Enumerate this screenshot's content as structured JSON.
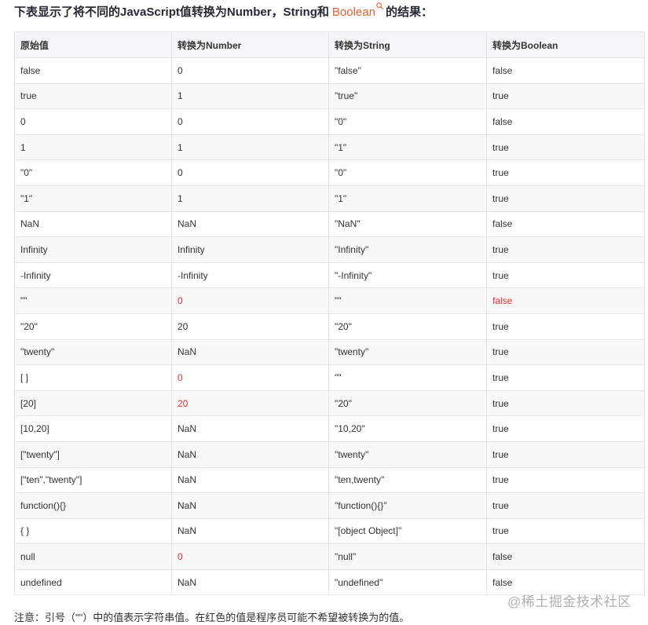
{
  "heading": {
    "before": "下表显示了将不同的JavaScript值转换为Number，String和",
    "link": "Boolean",
    "after": "的结果："
  },
  "table": {
    "headers": [
      "原始值",
      "转换为Number",
      "转换为String",
      "转换为Boolean"
    ],
    "rows": [
      [
        "false",
        "0",
        "\"false\"",
        "false"
      ],
      [
        "true",
        "1",
        "\"true\"",
        "true"
      ],
      [
        "0",
        "0",
        "\"0\"",
        "false"
      ],
      [
        "1",
        "1",
        "\"1\"",
        "true"
      ],
      [
        "\"0\"",
        "0",
        "\"0\"",
        "true"
      ],
      [
        "\"1\"",
        "1",
        "\"1\"",
        "true"
      ],
      [
        "NaN",
        "NaN",
        "\"NaN\"",
        "false"
      ],
      [
        "Infinity",
        "Infinity",
        "\"Infinity\"",
        "true"
      ],
      [
        "-Infinity",
        "-Infinity",
        "\"-Infinity\"",
        "true"
      ],
      [
        "\"\"",
        "0",
        "\"\"",
        "false"
      ],
      [
        "\"20\"",
        "20",
        "\"20\"",
        "true"
      ],
      [
        "\"twenty\"",
        "NaN",
        "\"twenty\"",
        "true"
      ],
      [
        "[ ]",
        "0",
        "\"\"",
        "true"
      ],
      [
        "[20]",
        "20",
        "\"20\"",
        "true"
      ],
      [
        "[10,20]",
        "NaN",
        "\"10,20\"",
        "true"
      ],
      [
        "[\"twenty\"]",
        "NaN",
        "\"twenty\"",
        "true"
      ],
      [
        "[\"ten\",\"twenty\"]",
        "NaN",
        "\"ten,twenty\"",
        "true"
      ],
      [
        "function(){}",
        "NaN",
        "\"function(){}\"",
        "true"
      ],
      [
        "{ }",
        "NaN",
        "\"[object Object]\"",
        "true"
      ],
      [
        "null",
        "0",
        "\"null\"",
        "false"
      ],
      [
        "undefined",
        "NaN",
        "\"undefined\"",
        "false"
      ]
    ],
    "highlight_cells": [
      [
        9,
        1
      ],
      [
        9,
        3
      ],
      [
        12,
        1
      ],
      [
        13,
        1
      ],
      [
        19,
        1
      ]
    ]
  },
  "note": "注意：引号（\"\"）中的值表示字符串值。在红色的值是程序员可能不希望被转换为的值。",
  "watermark": "@稀土掘金技术社区",
  "colors": {
    "link": "#e8602c",
    "highlight": "#e62d2d",
    "header_bg": "#f4f6f7",
    "stripe_bg": "#f8f8f8",
    "border": "#e6e6e6"
  }
}
